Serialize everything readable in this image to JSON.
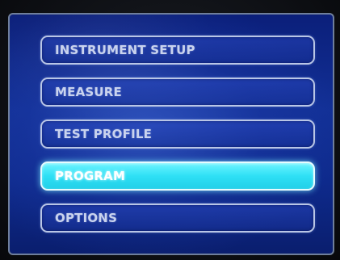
{
  "menu": {
    "items": [
      {
        "label": "INSTRUMENT SETUP",
        "selected": false
      },
      {
        "label": "MEASURE",
        "selected": false
      },
      {
        "label": "TEST PROFILE",
        "selected": false
      },
      {
        "label": "PROGRAM",
        "selected": true
      },
      {
        "label": "OPTIONS",
        "selected": false
      }
    ],
    "selected_index": 3
  },
  "colors": {
    "screen_background": "#123096",
    "item_border": "#b9c6e6",
    "item_text": "#c9d3ee",
    "selected_background": "#2ee0f5",
    "selected_text": "#ffffff"
  }
}
